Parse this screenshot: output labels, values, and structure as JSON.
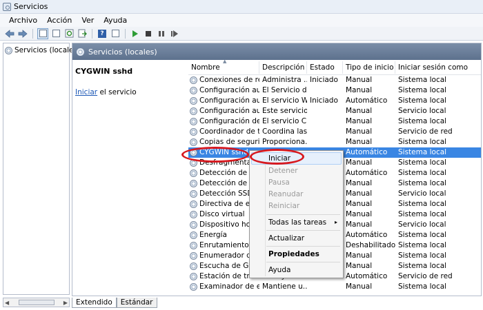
{
  "window": {
    "title": "Servicios"
  },
  "menu": [
    "Archivo",
    "Acción",
    "Ver",
    "Ayuda"
  ],
  "toolbar_icons": [
    "back-arrow-icon",
    "forward-arrow-icon",
    "console-tree-icon",
    "properties-icon",
    "refresh-icon",
    "export-icon",
    "help-icon",
    "start-service-icon",
    "stop-service-icon",
    "pause-service-icon",
    "restart-service-icon"
  ],
  "tree": {
    "root_label": "Servicios (locales)"
  },
  "main": {
    "header": "Servicios (locales)",
    "selected_service": "CYGWIN sshd",
    "action_link": "Iniciar",
    "action_text": " el servicio"
  },
  "columns": [
    "Nombre",
    "Descripción",
    "Estado",
    "Tipo de inicio",
    "Iniciar sesión como"
  ],
  "rows": [
    [
      "Conexiones de red",
      "Administra ...",
      "Iniciado",
      "Manual",
      "Sistema local"
    ],
    [
      "Configuración aut...",
      "El Servicio d...",
      "",
      "Manual",
      "Sistema local"
    ],
    [
      "Configuración aut...",
      "El servicio W...",
      "Iniciado",
      "Automático",
      "Sistema local"
    ],
    [
      "Configuración aut...",
      "Este servicio...",
      "",
      "Manual",
      "Servicio local"
    ],
    [
      "Configuración de ...",
      "El servicio C...",
      "",
      "Manual",
      "Sistema local"
    ],
    [
      "Coordinador de tr...",
      "Coordina las...",
      "",
      "Manual",
      "Servicio de red"
    ],
    [
      "Copias de segurid...",
      "Proporciona...",
      "",
      "Manual",
      "Sistema local"
    ],
    [
      "CYGWIN sshd",
      "",
      "",
      "Automático",
      "Sistema local"
    ],
    [
      "Desfragmentador",
      "",
      "",
      "Manual",
      "Sistema local"
    ],
    [
      "Detección de har",
      "",
      "",
      "Automático",
      "Sistema local"
    ],
    [
      "Detección de ser",
      "",
      "",
      "Manual",
      "Sistema local"
    ],
    [
      "Detección SSDP",
      "",
      "",
      "Manual",
      "Servicio local"
    ],
    [
      "Directiva de extra",
      "",
      "",
      "Manual",
      "Sistema local"
    ],
    [
      "Disco virtual",
      "",
      "",
      "Manual",
      "Sistema local"
    ],
    [
      "Dispositivo host c",
      "",
      "",
      "Manual",
      "Servicio local"
    ],
    [
      "Energía",
      "",
      "",
      "Automático",
      "Sistema local"
    ],
    [
      "Enrutamiento y a",
      "",
      "",
      "Deshabilitado",
      "Sistema local"
    ],
    [
      "Enumerador de b",
      "",
      "",
      "Manual",
      "Sistema local"
    ],
    [
      "Escucha de Grup",
      "",
      "",
      "Manual",
      "Sistema local"
    ],
    [
      "Estación de trabajo",
      "Crea y mant...",
      "Iniciado",
      "Automático",
      "Servicio de red"
    ],
    [
      "Examinador de eq...",
      "Mantiene u...",
      "",
      "Manual",
      "Sistema local"
    ]
  ],
  "context_menu": {
    "items": [
      "Iniciar",
      "Detener",
      "Pausa",
      "Reanudar",
      "Reiniciar",
      "Todas las tareas",
      "Actualizar",
      "Propiedades",
      "Ayuda"
    ],
    "submenu_arrow": "▸"
  },
  "tabs": [
    "Extendido",
    "Estándar"
  ],
  "annotation_color": "#d7191f",
  "selection_color": "#3a86e3"
}
